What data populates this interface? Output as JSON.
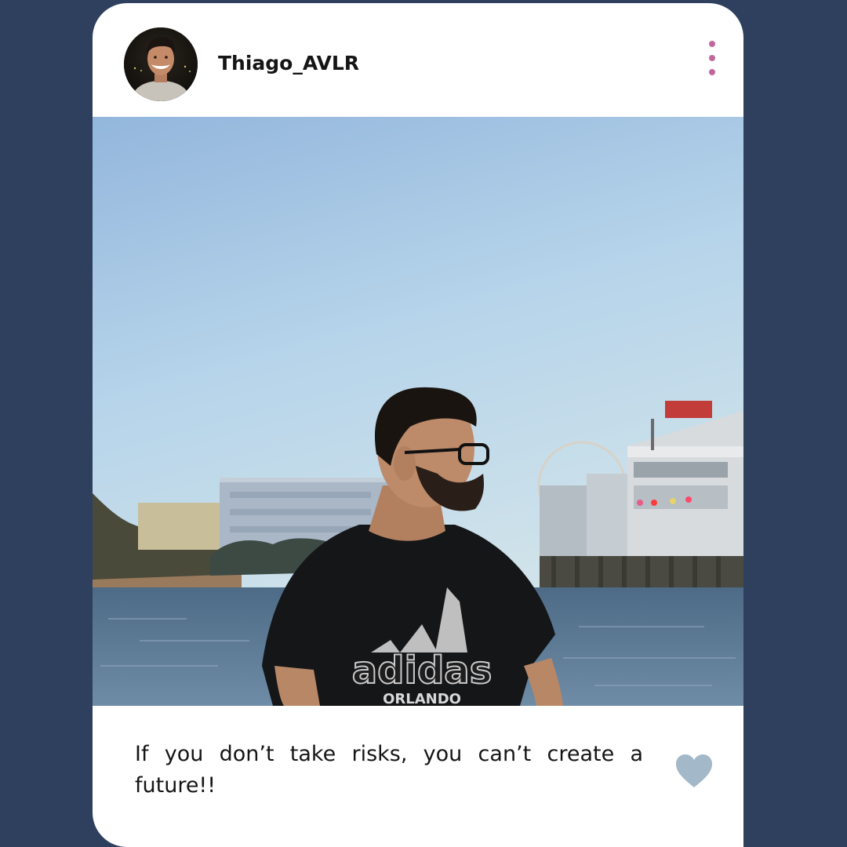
{
  "post": {
    "username": "Thiago_AVLR",
    "caption": "If you don’t take risks, you can’t create a future!!",
    "photo_shirt_brand": "adidas",
    "photo_shirt_city": "ORLANDO"
  },
  "colors": {
    "page_background": "#2e405e",
    "card_background": "#ffffff",
    "menu_dots": "#c0689e",
    "heart": "#a3b8c8",
    "text": "#151515"
  },
  "icons": {
    "menu": "vertical-ellipsis-icon",
    "like": "heart-icon"
  }
}
